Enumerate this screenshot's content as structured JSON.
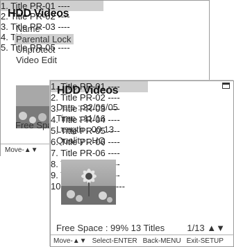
{
  "back": {
    "title": "HDD Videos",
    "menu": [
      "Name",
      "Parental Lock",
      "Unprotect",
      "Video Edit"
    ],
    "list": [
      "1. Title PR-01 ----",
      "2. Title PR-02 ----",
      "3. Title PR-03 ----",
      "4. Title PR-04 ----",
      "5. Title PR-05 ----"
    ],
    "free_space": "Free Spa",
    "hint": "Move-▲▼"
  },
  "front": {
    "title": "HDD Videos",
    "info": [
      "Date : 22/06/05",
      "Time : 11/16",
      "Length : 00:13",
      "Quality : HQ"
    ],
    "list": [
      "1. Title PR-01 ----",
      "2. Title PR-02 ----",
      "3. Title PR-03 ----",
      "4. Title PR-04 ----",
      "5. Title PR-05 ----",
      "6. Title PR-06 ----",
      "7. Title PR-06 ----",
      "8. Title PR-06 ----",
      "9. Title PR-06 ----",
      "10. Title PR-06 ----"
    ],
    "status": "Free Space : 99% 13 Titles",
    "page": "1/13 ▲▼",
    "hints": {
      "move": "Move-▲▼",
      "select": "Select-ENTER",
      "back": "Back-MENU",
      "exit": "Exit-SETUP"
    },
    "selected_icon": "folder-icon"
  },
  "colors": {
    "highlight": "#cfcfcf",
    "border": "#9a9a9a",
    "text": "#333333"
  }
}
